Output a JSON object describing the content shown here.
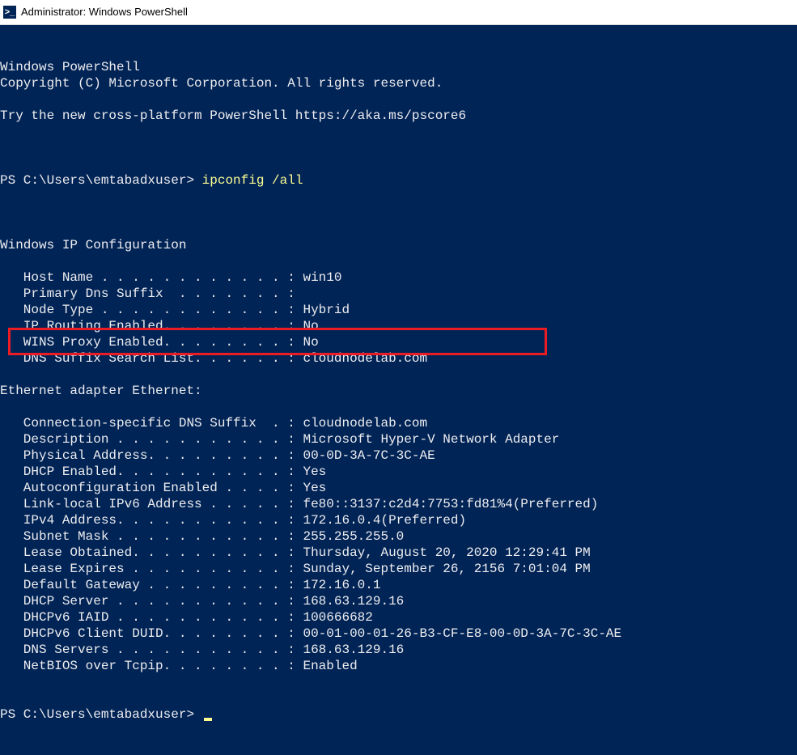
{
  "window": {
    "title": "Administrator: Windows PowerShell",
    "icon_label": ">_"
  },
  "terminal": {
    "lines": [
      "Windows PowerShell",
      "Copyright (C) Microsoft Corporation. All rights reserved.",
      "",
      "Try the new cross-platform PowerShell https://aka.ms/pscore6",
      ""
    ],
    "prompt1_prefix": "PS C:\\Users\\emtabadxuser> ",
    "prompt1_cmd": "ipconfig /all",
    "after_cmd": [
      "",
      "Windows IP Configuration",
      "",
      "   Host Name . . . . . . . . . . . . : win10",
      "   Primary Dns Suffix  . . . . . . . :",
      "   Node Type . . . . . . . . . . . . : Hybrid",
      "   IP Routing Enabled. . . . . . . . : No",
      "   WINS Proxy Enabled. . . . . . . . : No",
      "   DNS Suffix Search List. . . . . . : cloudnodelab.com",
      "",
      "Ethernet adapter Ethernet:",
      "",
      "   Connection-specific DNS Suffix  . : cloudnodelab.com",
      "   Description . . . . . . . . . . . : Microsoft Hyper-V Network Adapter",
      "   Physical Address. . . . . . . . . : 00-0D-3A-7C-3C-AE",
      "   DHCP Enabled. . . . . . . . . . . : Yes",
      "   Autoconfiguration Enabled . . . . : Yes",
      "   Link-local IPv6 Address . . . . . : fe80::3137:c2d4:7753:fd81%4(Preferred)",
      "   IPv4 Address. . . . . . . . . . . : 172.16.0.4(Preferred)",
      "   Subnet Mask . . . . . . . . . . . : 255.255.255.0",
      "   Lease Obtained. . . . . . . . . . : Thursday, August 20, 2020 12:29:41 PM",
      "   Lease Expires . . . . . . . . . . : Sunday, September 26, 2156 7:01:04 PM",
      "   Default Gateway . . . . . . . . . : 172.16.0.1",
      "   DHCP Server . . . . . . . . . . . : 168.63.129.16",
      "   DHCPv6 IAID . . . . . . . . . . . : 100666682",
      "   DHCPv6 Client DUID. . . . . . . . : 00-01-00-01-26-B3-CF-E8-00-0D-3A-7C-3C-AE",
      "   DNS Servers . . . . . . . . . . . : 168.63.129.16",
      "   NetBIOS over Tcpip. . . . . . . . : Enabled"
    ],
    "prompt2_prefix": "PS C:\\Users\\emtabadxuser> "
  }
}
